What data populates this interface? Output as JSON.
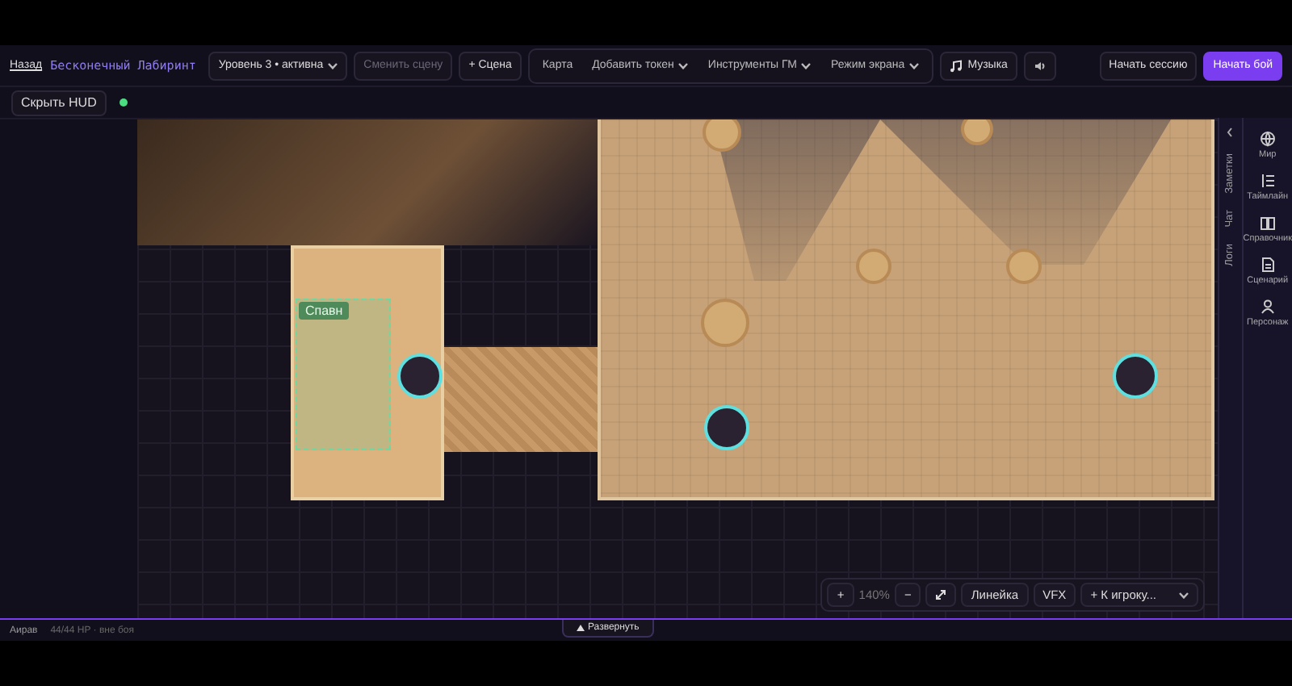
{
  "header": {
    "back_link": "Назад",
    "campaign_title": "Бесконечный Лабиринт",
    "scene_select": "Уровень 3 • активна",
    "change_scene": {
      "label": "Сменить сцену",
      "disabled": true
    },
    "add_scene": "+ Сцена",
    "toolbar": [
      {
        "label": "Карта",
        "kind": "plain"
      },
      {
        "label": "Добавить токен",
        "kind": "menu"
      },
      {
        "label": "Инструменты ГМ",
        "kind": "menu"
      },
      {
        "label": "Режим экрана",
        "kind": "menu"
      }
    ],
    "music": "Музыка",
    "start_session": "Начать сессию",
    "start_combat": "Начать бой"
  },
  "hud": {
    "toggle": "Скрыть HUD",
    "connected": true
  },
  "map": {
    "zone_label": "Спавн"
  },
  "map_controls": {
    "zoom_in": "+",
    "zoom": "140%",
    "zoom_out": "−",
    "ruler": "Линейка",
    "vfx": "VFX",
    "go_to_player": "+ К игроку..."
  },
  "side_panel": {
    "tabs": [
      {
        "label": "Заметки",
        "selected": false
      },
      {
        "label": "Чат",
        "selected": false
      },
      {
        "label": "Логи",
        "selected": false
      }
    ],
    "nav": [
      {
        "label": "Мир"
      },
      {
        "label": "Таймлайн"
      },
      {
        "label": "Справочник"
      },
      {
        "label": "Сценарий"
      },
      {
        "label": "Персонаж"
      }
    ]
  },
  "status_bar": {
    "character": "Аирав",
    "stats": "44/44 HP · вне боя",
    "expand": "Развернуть"
  }
}
